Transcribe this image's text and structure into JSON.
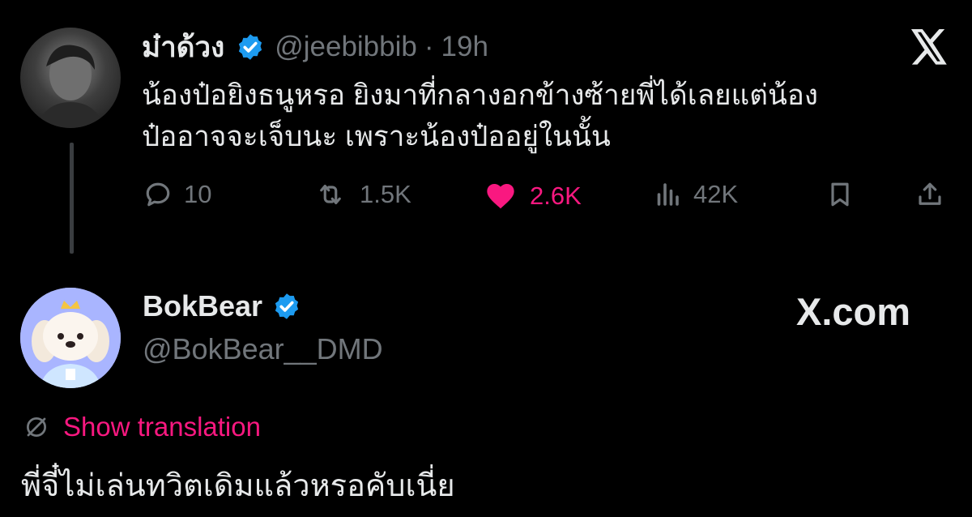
{
  "tweet": {
    "author_name": "ม๋าด้วง",
    "handle": "@jeebibbib",
    "separator": "·",
    "time": "19h",
    "text_line1": "น้องป๋อยิงธนูหรอ ยิงมาที่กลางอกข้างซ้ายพี่ได้เลยแต่น้อง",
    "text_line2": "ป๋ออาจจะเจ็บนะ เพราะน้องป๋ออยู่ในนั้น",
    "replies": "10",
    "reposts": "1.5K",
    "likes": "2.6K",
    "views": "42K"
  },
  "quote": {
    "author_name": "BokBear",
    "handle": "@BokBear__DMD",
    "site_label": "X.com",
    "translate_label": "Show translation",
    "text": "พี่จี๋ไม่เล่นทวิตเดิมแล้วหรอคับเนี่ย"
  },
  "colors": {
    "background": "#000000",
    "text": "#e7e9ea",
    "muted": "#71767b",
    "like_pink": "#f91880",
    "verified_blue": "#1d9bf0",
    "thread_line": "#3a3d40"
  },
  "icons": [
    "verified-badge-icon",
    "x-logo-icon",
    "reply-icon",
    "repost-icon",
    "like-icon",
    "views-icon",
    "bookmark-icon",
    "share-icon",
    "translate-icon"
  ]
}
